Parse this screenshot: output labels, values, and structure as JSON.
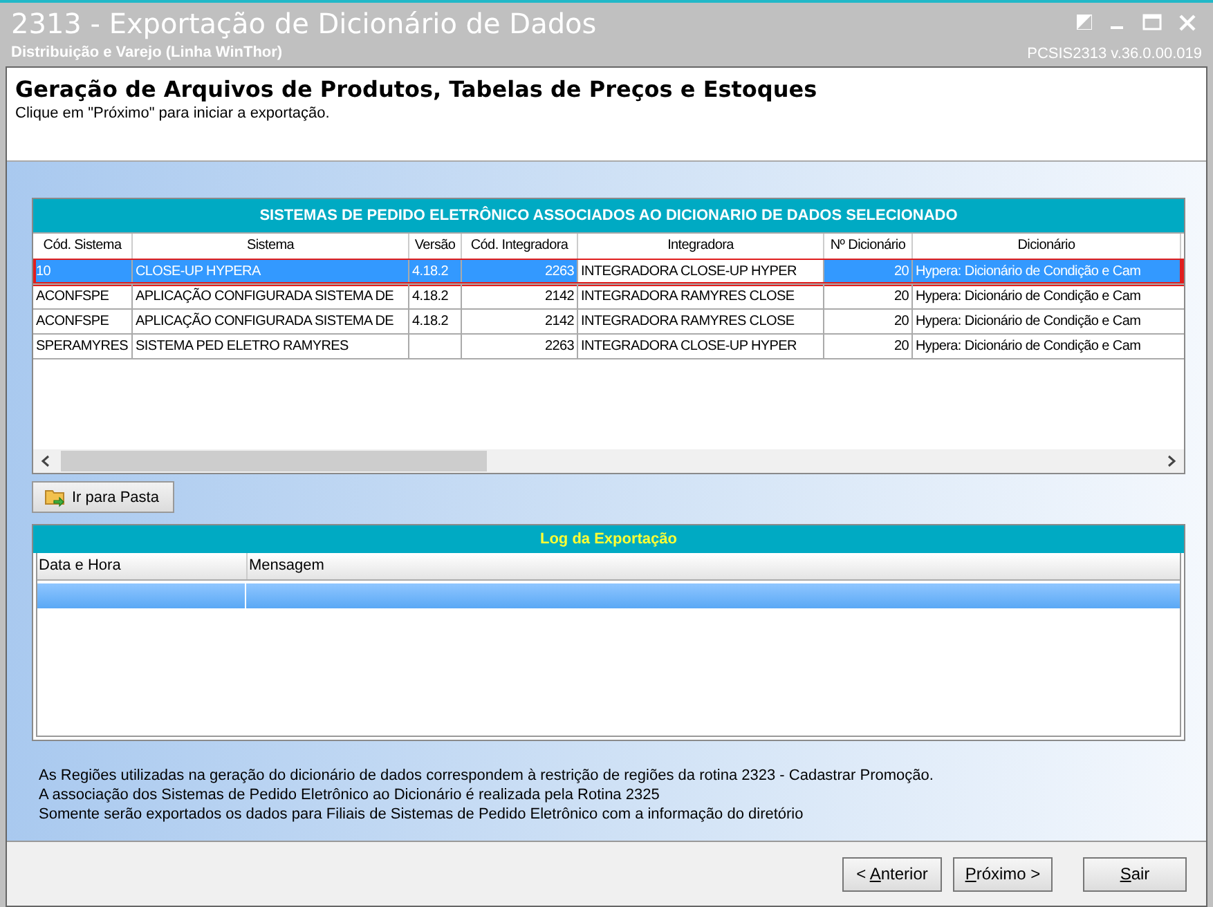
{
  "window": {
    "title": "2313 - Exportação de Dicionário de Dados",
    "subtitle": "Distribuição e Varejo (Linha WinThor)",
    "version": "PCSIS2313  v.36.0.00.019"
  },
  "header": {
    "title": "Geração de Arquivos de Produtos, Tabelas de Preços e Estoques",
    "instruction": "Clique em \"Próximo\" para iniciar a exportação."
  },
  "systems_grid": {
    "title": "SISTEMAS DE PEDIDO ELETRÔNICO ASSOCIADOS AO DICIONARIO DE DADOS SELECIONADO",
    "columns": [
      "Cód. Sistema",
      "Sistema",
      "Versão",
      "Cód. Integradora",
      "Integradora",
      "Nº Dicionário",
      "Dicionário"
    ],
    "rows": [
      {
        "selected": true,
        "outlined": true,
        "cells": [
          "10",
          "CLOSE-UP HYPERA",
          "4.18.2",
          "2263",
          "INTEGRADORA CLOSE-UP HYPER",
          "20",
          "Hypera: Dicionário de Condição e Cam"
        ]
      },
      {
        "selected": false,
        "outlined": false,
        "cells": [
          "ACONFSPE",
          "APLICAÇÃO CONFIGURADA SISTEMA DE",
          "4.18.2",
          "2142",
          "INTEGRADORA RAMYRES CLOSE",
          "20",
          "Hypera: Dicionário de Condição e Cam"
        ]
      },
      {
        "selected": false,
        "outlined": false,
        "cells": [
          "ACONFSPE",
          "APLICAÇÃO CONFIGURADA SISTEMA DE",
          "4.18.2",
          "2142",
          "INTEGRADORA RAMYRES CLOSE",
          "20",
          "Hypera: Dicionário de Condição e Cam"
        ]
      },
      {
        "selected": false,
        "outlined": false,
        "cells": [
          "SPERAMYRES",
          "SISTEMA PED ELETRO RAMYRES",
          "",
          "2263",
          "INTEGRADORA CLOSE-UP HYPER",
          "20",
          "Hypera: Dicionário de Condição e Cam"
        ]
      }
    ]
  },
  "folder_button": {
    "label": "Ir para Pasta"
  },
  "log_grid": {
    "title": "Log da Exportação",
    "columns": [
      "Data e Hora",
      "Mensagem"
    ],
    "rows": [
      {
        "selected": true
      }
    ]
  },
  "notes": [
    "As Regiões utilizadas na geração do dicionário de dados correspondem à restrição de regiões da rotina 2323 - Cadastrar Promoção.",
    "A associação dos Sistemas de Pedido Eletrônico ao Dicionário é realizada pela Rotina 2325",
    "Somente serão exportados os dados para Filiais de Sistemas de Pedido Eletrônico com a informação do diretório"
  ],
  "buttons": [
    "< Anterior",
    "Próximo >",
    "Sair"
  ]
}
